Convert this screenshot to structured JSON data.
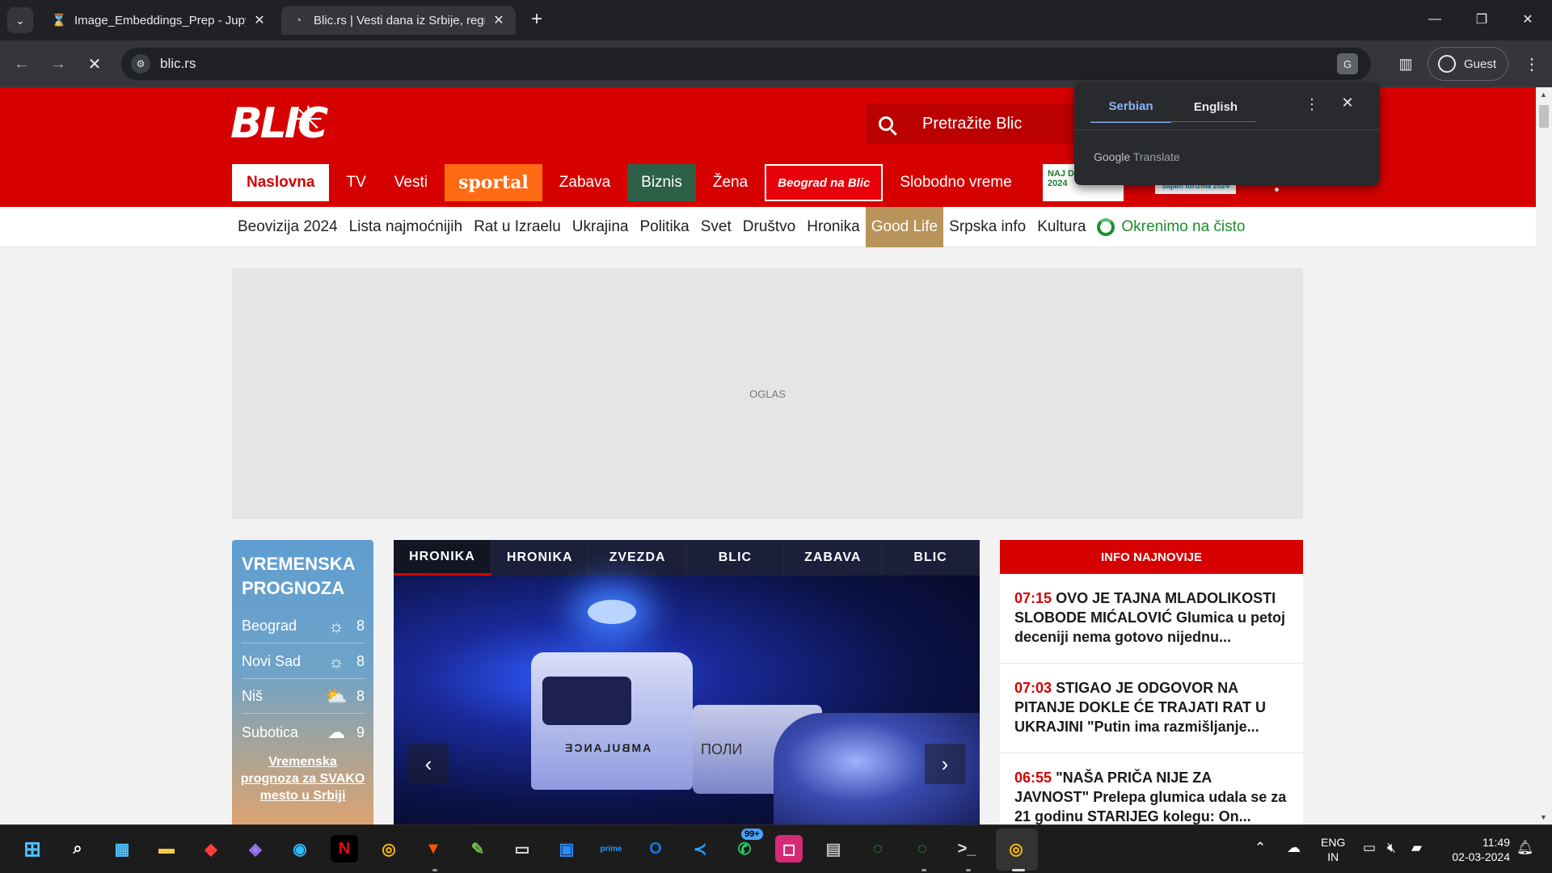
{
  "browser": {
    "tabs": [
      {
        "title": "Image_Embeddings_Prep - Jupyt",
        "favicon": "hourglass-icon",
        "active": false
      },
      {
        "title": "Blic.rs | Vesti dana iz Srbije, regi",
        "favicon": "loading-icon",
        "active": true
      }
    ],
    "url": "blic.rs",
    "profile_label": "Guest"
  },
  "translate_popup": {
    "tabs": [
      "Serbian",
      "English"
    ],
    "selected": "Serbian",
    "brand_google": "Google",
    "brand_translate": "Translate"
  },
  "site": {
    "logo": "BLIC",
    "search_placeholder": "Pretražite Blic",
    "main_nav": [
      "Naslovna",
      "TV",
      "Vesti",
      "sportal",
      "Zabava",
      "Biznis",
      "Žena",
      "Beograd na Blic",
      "Slobodno vreme"
    ],
    "promo1": "NAJ DOMAĆI 2024",
    "promo2": "Sajam turizma 2024",
    "sub_nav": [
      "Beovizija 2024",
      "Lista najmoćnijih",
      "Rat u Izraelu",
      "Ukrajina",
      "Politika",
      "Svet",
      "Društvo",
      "Hronika",
      "Good Life",
      "Srpska info",
      "Kultura"
    ],
    "green_link": "Okrenimo na čisto",
    "ad_label": "OGLAS",
    "weather": {
      "title_line1": "VREMENSKA",
      "title_line2": "PROGNOZA",
      "rows": [
        {
          "city": "Beograd",
          "icon": "sun-icon",
          "temp": "8"
        },
        {
          "city": "Novi Sad",
          "icon": "sun-icon",
          "temp": "8"
        },
        {
          "city": "Niš",
          "icon": "partly-cloudy-icon",
          "temp": "8"
        },
        {
          "city": "Subotica",
          "icon": "rain-cloud-icon",
          "temp": "9"
        }
      ],
      "link": "Vremenska prognoza za SVAKO mesto u Srbiji"
    },
    "slider": {
      "tabs": [
        "HRONIKA",
        "HRONIKA",
        "ZVEZDA",
        "BLIC",
        "ZABAVA",
        "BLIC"
      ],
      "active_tab": 0,
      "ambulance_text": "AMBULANCE",
      "van_text": "ПОЛИ"
    },
    "news": {
      "header": "INFO NAJNOVIJE",
      "items": [
        {
          "time": "07:15",
          "text": "OVO JE TAJNA MLADOLIKOSTI SLOBODE MIĆALOVIĆ Glumica u petoj deceniji nema gotovo nijednu..."
        },
        {
          "time": "07:03",
          "text": "STIGAO JE ODGOVOR NA PITANJE DOKLE ĆE TRAJATI RAT U UKRAJINI \"Putin ima razmišljanje..."
        },
        {
          "time": "06:55",
          "text": "\"NAŠA PRIČA NIJE ZA JAVNOST\" Prelepa glumica udala se za 21 godinu STARIJEG kolegu: On..."
        }
      ]
    }
  },
  "taskbar": {
    "badge": "99+",
    "lang_line1": "ENG",
    "lang_line2": "IN",
    "time": "11:49",
    "date": "02-03-2024"
  }
}
